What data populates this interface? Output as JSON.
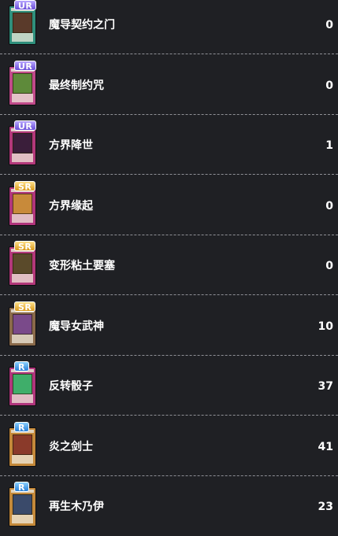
{
  "cards": [
    {
      "rarity": "UR",
      "name": "魔导契约之门",
      "count": "0",
      "card_color": "#2f8f7c",
      "art_color": "#5a3a2a"
    },
    {
      "rarity": "UR",
      "name": "最终制约咒",
      "count": "0",
      "card_color": "#c04a8a",
      "art_color": "#5e8a3a"
    },
    {
      "rarity": "UR",
      "name": "方界降世",
      "count": "1",
      "card_color": "#b2387a",
      "art_color": "#3a1e3a"
    },
    {
      "rarity": "SR",
      "name": "方界缘起",
      "count": "0",
      "card_color": "#b0357c",
      "art_color": "#c88a3a"
    },
    {
      "rarity": "SR",
      "name": "变形粘土要塞",
      "count": "0",
      "card_color": "#b2387a",
      "art_color": "#5a4a2a"
    },
    {
      "rarity": "SR",
      "name": "魔导女武神",
      "count": "10",
      "card_color": "#8a6a4a",
      "art_color": "#7a4a8a"
    },
    {
      "rarity": "R",
      "name": "反转骰子",
      "count": "37",
      "card_color": "#b0357c",
      "art_color": "#3fae6a"
    },
    {
      "rarity": "R",
      "name": "炎之剑士",
      "count": "41",
      "card_color": "#c4893a",
      "art_color": "#8a3a2a"
    },
    {
      "rarity": "R",
      "name": "再生木乃伊",
      "count": "23",
      "card_color": "#c4893a",
      "art_color": "#3a4a6a"
    }
  ]
}
